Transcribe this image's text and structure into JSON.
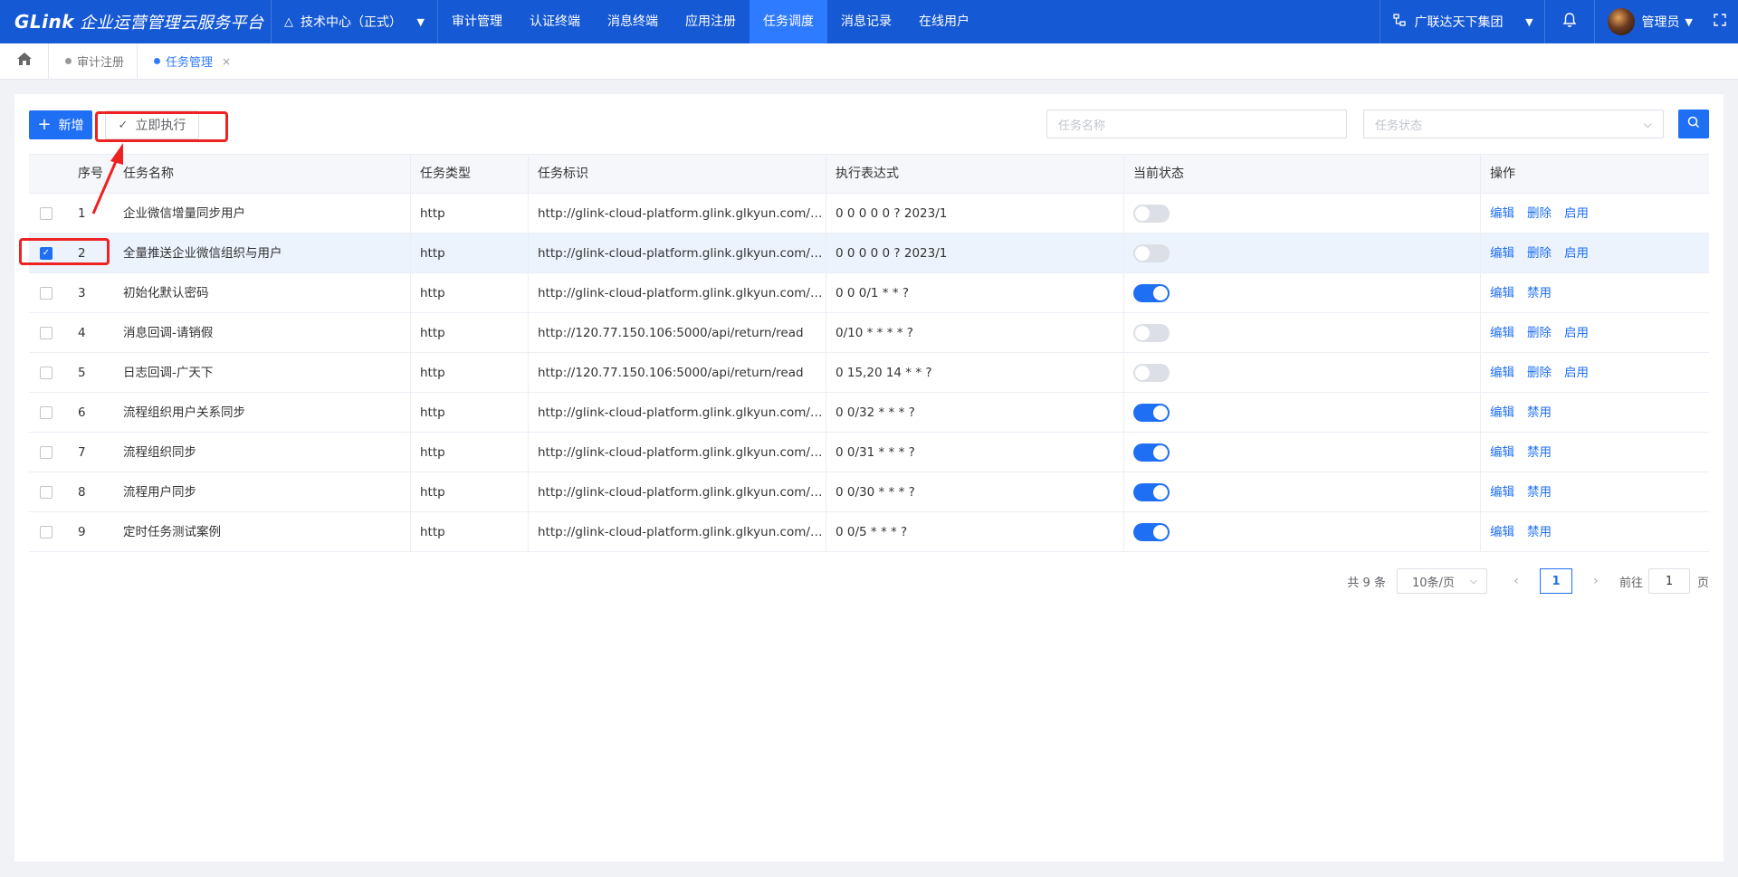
{
  "app": {
    "logo_mark": "GLink",
    "title": "企业运营管理云服务平台"
  },
  "org_select": {
    "label": "技术中心（正式）"
  },
  "nav": {
    "items": [
      {
        "label": "审计管理"
      },
      {
        "label": "认证终端"
      },
      {
        "label": "消息终端"
      },
      {
        "label": "应用注册"
      },
      {
        "label": "任务调度"
      },
      {
        "label": "消息记录"
      },
      {
        "label": "在线用户"
      }
    ],
    "active": "任务调度"
  },
  "company": {
    "label": "广联达天下集团"
  },
  "user": {
    "name": "管理员"
  },
  "tabs": [
    {
      "label": "审计注册"
    },
    {
      "label": "任务管理"
    }
  ],
  "toolbar": {
    "add_label": "新增",
    "run_label": "立即执行",
    "search_placeholder": "任务名称",
    "status_placeholder": "任务状态"
  },
  "table": {
    "columns": {
      "no": "序号",
      "name": "任务名称",
      "type": "任务类型",
      "url": "任务标识",
      "expr": "执行表达式",
      "state": "当前状态",
      "ops": "操作"
    },
    "rows": [
      {
        "no": "1",
        "name": "企业微信增量同步用户",
        "type": "http",
        "url": "http://glink-cloud-platform.glink.glkyun.com/ap...",
        "expr": "0 0 0 0 0 ? 2023/1",
        "enabled": false,
        "checked": false,
        "ops": [
          "编辑",
          "删除",
          "启用"
        ]
      },
      {
        "no": "2",
        "name": "全量推送企业微信组织与用户",
        "type": "http",
        "url": "http://glink-cloud-platform.glink.glkyun.com/ap...",
        "expr": "0 0 0 0 0 ? 2023/1",
        "enabled": false,
        "checked": true,
        "ops": [
          "编辑",
          "删除",
          "启用"
        ]
      },
      {
        "no": "3",
        "name": "初始化默认密码",
        "type": "http",
        "url": "http://glink-cloud-platform.glink.glkyun.com/ap...",
        "expr": "0 0 0/1 * * ?",
        "enabled": true,
        "checked": false,
        "ops": [
          "编辑",
          "禁用"
        ]
      },
      {
        "no": "4",
        "name": "消息回调-请销假",
        "type": "http",
        "url": "http://120.77.150.106:5000/api/return/read",
        "expr": "0/10 * * * * ?",
        "enabled": false,
        "checked": false,
        "ops": [
          "编辑",
          "删除",
          "启用"
        ]
      },
      {
        "no": "5",
        "name": "日志回调-广天下",
        "type": "http",
        "url": "http://120.77.150.106:5000/api/return/read",
        "expr": "0 15,20 14 * * ?",
        "enabled": false,
        "checked": false,
        "ops": [
          "编辑",
          "删除",
          "启用"
        ]
      },
      {
        "no": "6",
        "name": "流程组织用户关系同步",
        "type": "http",
        "url": "http://glink-cloud-platform.glink.glkyun.com/ap...",
        "expr": "0 0/32 * * * ?",
        "enabled": true,
        "checked": false,
        "ops": [
          "编辑",
          "禁用"
        ]
      },
      {
        "no": "7",
        "name": "流程组织同步",
        "type": "http",
        "url": "http://glink-cloud-platform.glink.glkyun.com/ap...",
        "expr": "0 0/31 * * * ?",
        "enabled": true,
        "checked": false,
        "ops": [
          "编辑",
          "禁用"
        ]
      },
      {
        "no": "8",
        "name": "流程用户同步",
        "type": "http",
        "url": "http://glink-cloud-platform.glink.glkyun.com/ap...",
        "expr": "0 0/30 * * * ?",
        "enabled": true,
        "checked": false,
        "ops": [
          "编辑",
          "禁用"
        ]
      },
      {
        "no": "9",
        "name": "定时任务测试案例",
        "type": "http",
        "url": "http://glink-cloud-platform.glink.glkyun.com/ap...",
        "expr": "0 0/5 * * * ?",
        "enabled": true,
        "checked": false,
        "ops": [
          "编辑",
          "禁用"
        ]
      }
    ]
  },
  "pagination": {
    "total": "共 9 条",
    "page_size": "10条/页",
    "current": "1",
    "goto_label": "前往",
    "goto_value": "1",
    "unit": "页"
  },
  "colors": {
    "brand": "#1659d4",
    "accent": "#1f6ff5",
    "annotation": "#ee2222"
  },
  "icons": [
    "home-icon",
    "bell-icon",
    "search-icon",
    "check-icon",
    "plus-icon",
    "fullscreen-icon",
    "tree-icon"
  ]
}
